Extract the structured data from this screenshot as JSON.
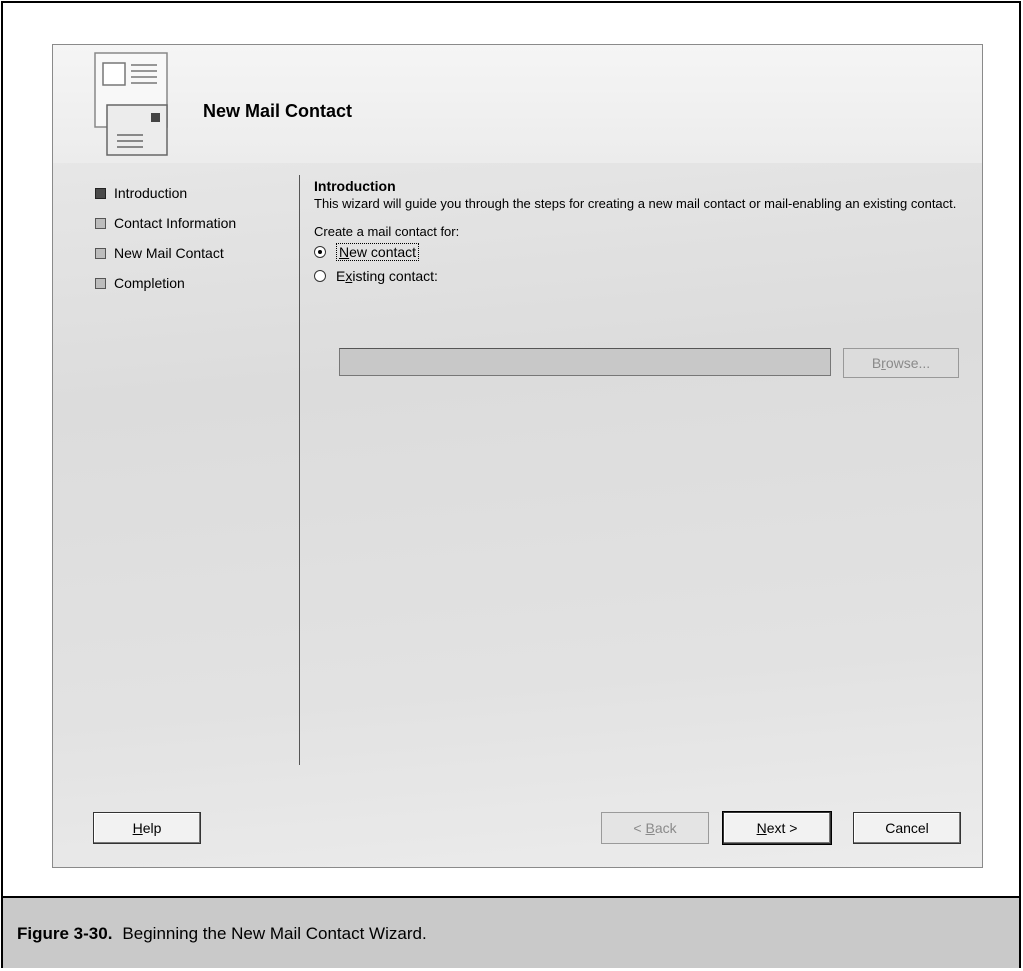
{
  "wizard": {
    "title": "New Mail Contact",
    "icon": "mail-contact-icon"
  },
  "steps": [
    {
      "label": "Introduction",
      "active": true
    },
    {
      "label": "Contact Information",
      "active": false
    },
    {
      "label": "New Mail Contact",
      "active": false
    },
    {
      "label": "Completion",
      "active": false
    }
  ],
  "content": {
    "section_title": "Introduction",
    "intro_text": "This wizard will guide you through the steps for creating a new mail contact or mail-enabling an existing contact.",
    "prompt": "Create a mail contact for:",
    "radio_new": {
      "pre": "",
      "accel": "N",
      "post": "ew contact",
      "checked": true
    },
    "radio_existing": {
      "pre": "E",
      "accel": "x",
      "post": "isting contact:",
      "checked": false
    },
    "existing_value": "",
    "browse": {
      "pre": "B",
      "accel": "r",
      "post": "owse..."
    }
  },
  "buttons": {
    "help": {
      "pre": "",
      "accel": "H",
      "post": "elp"
    },
    "back": {
      "pre": "< ",
      "accel": "B",
      "post": "ack"
    },
    "next": {
      "pre": "",
      "accel": "N",
      "post": "ext >"
    },
    "cancel": "Cancel"
  },
  "caption": {
    "number": "Figure 3-30.",
    "text": "Beginning the New Mail Contact Wizard."
  }
}
